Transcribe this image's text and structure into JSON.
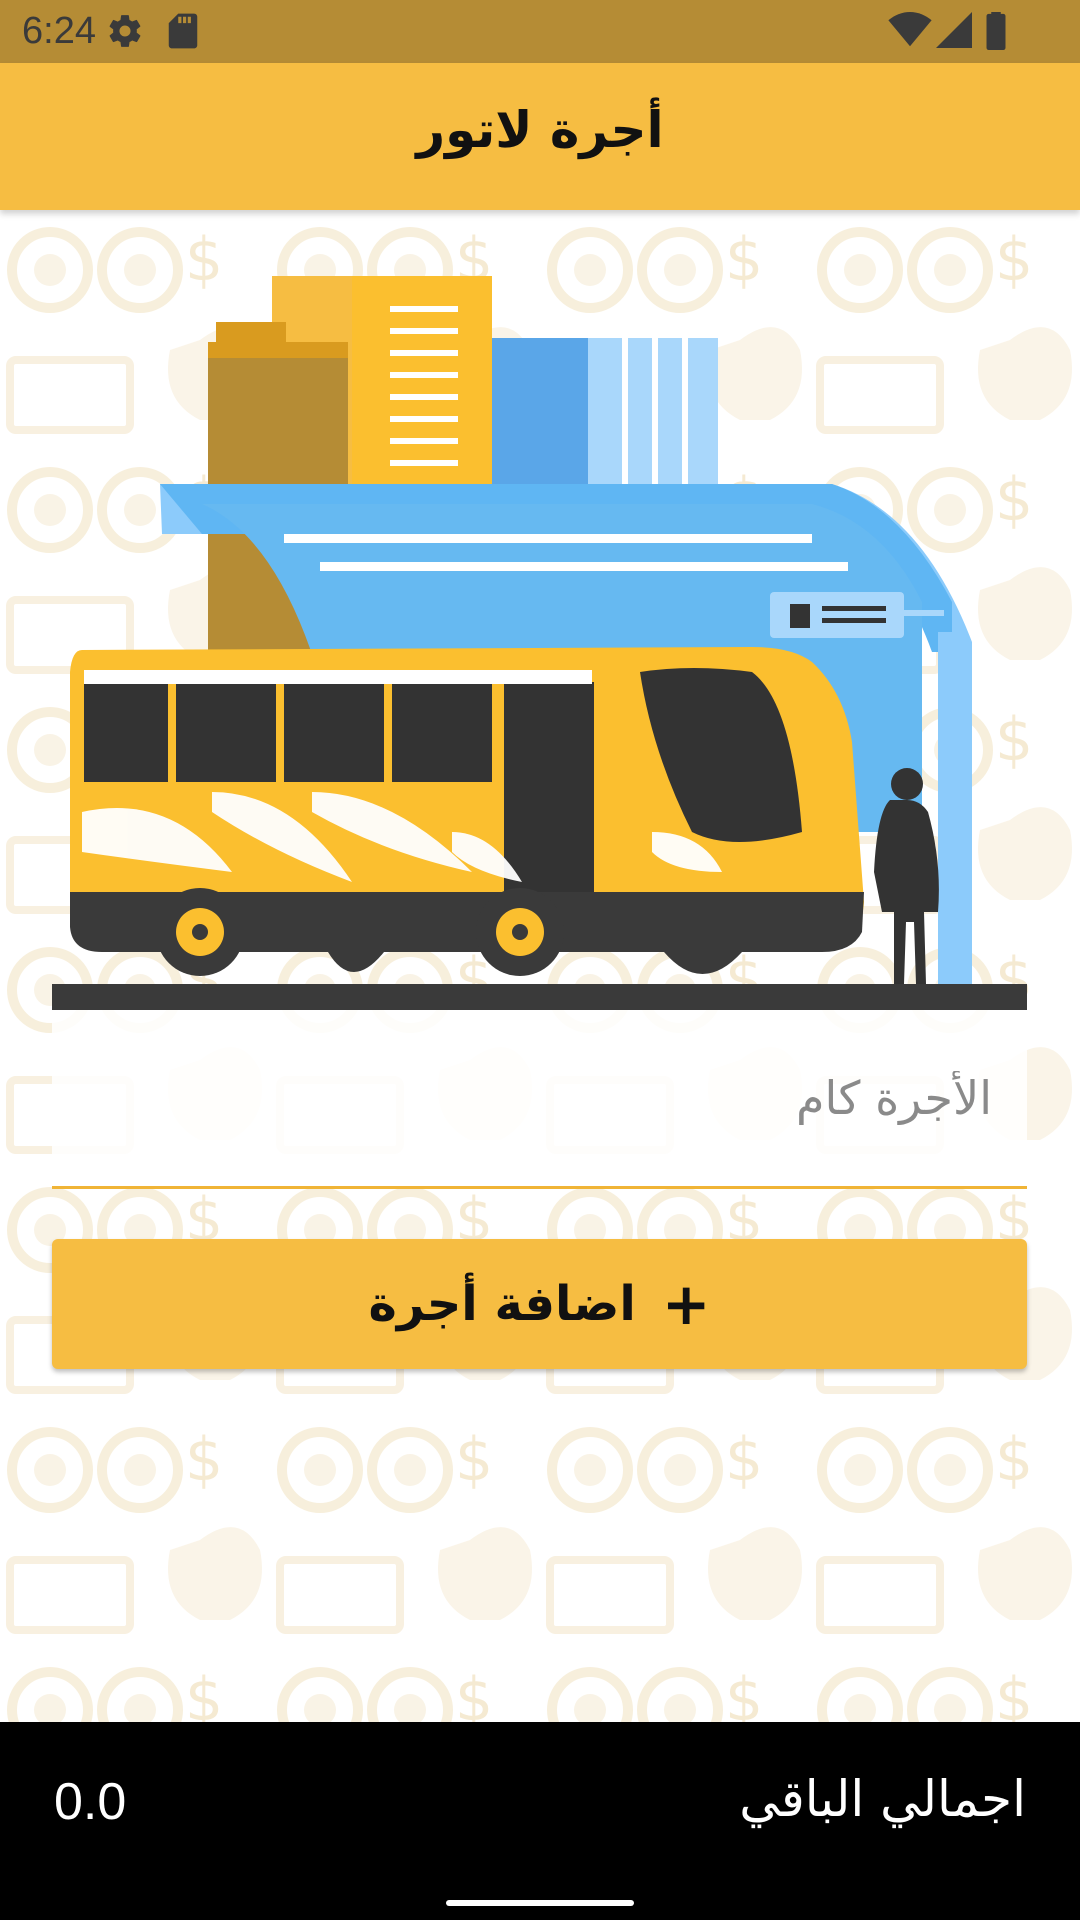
{
  "status_bar": {
    "time": "6:24",
    "left_icons": [
      "gear-icon",
      "sd-card-icon"
    ],
    "right_icons": [
      "wifi-icon",
      "signal-icon",
      "battery-icon"
    ]
  },
  "app_bar": {
    "title": "أجرة لاتور"
  },
  "illustration": {
    "subject": "bus-stop-illustration"
  },
  "fare_input": {
    "placeholder": "الأجرة كام",
    "value": ""
  },
  "add_button": {
    "icon": "plus-icon",
    "plus": "+",
    "label": "اضافة أجرة"
  },
  "bottom_bar": {
    "total_label": "اجمالي الباقي",
    "total_value": "0.0"
  },
  "colors": {
    "status_bar": "#b58c35",
    "primary": "#f6bd42",
    "bottom_bar": "#000000"
  }
}
